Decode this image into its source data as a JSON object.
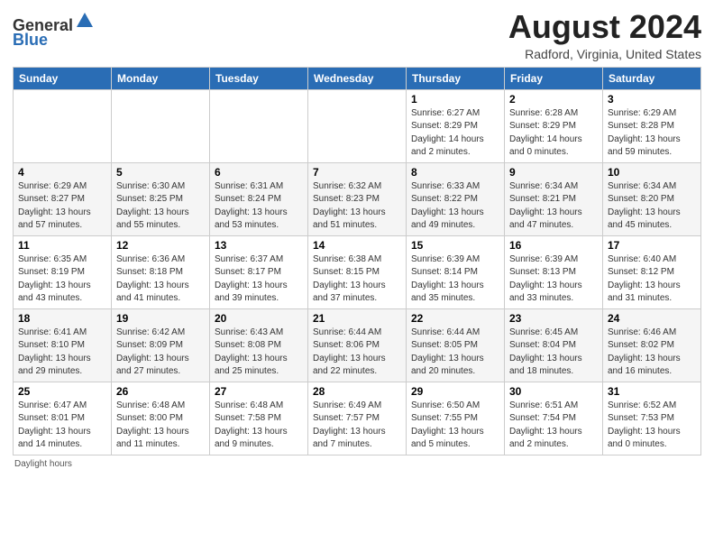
{
  "header": {
    "logo_general": "General",
    "logo_blue": "Blue",
    "month_title": "August 2024",
    "location": "Radford, Virginia, United States"
  },
  "weekdays": [
    "Sunday",
    "Monday",
    "Tuesday",
    "Wednesday",
    "Thursday",
    "Friday",
    "Saturday"
  ],
  "weeks": [
    [
      {
        "day": "",
        "info": ""
      },
      {
        "day": "",
        "info": ""
      },
      {
        "day": "",
        "info": ""
      },
      {
        "day": "",
        "info": ""
      },
      {
        "day": "1",
        "info": "Sunrise: 6:27 AM\nSunset: 8:29 PM\nDaylight: 14 hours\nand 2 minutes."
      },
      {
        "day": "2",
        "info": "Sunrise: 6:28 AM\nSunset: 8:29 PM\nDaylight: 14 hours\nand 0 minutes."
      },
      {
        "day": "3",
        "info": "Sunrise: 6:29 AM\nSunset: 8:28 PM\nDaylight: 13 hours\nand 59 minutes."
      }
    ],
    [
      {
        "day": "4",
        "info": "Sunrise: 6:29 AM\nSunset: 8:27 PM\nDaylight: 13 hours\nand 57 minutes."
      },
      {
        "day": "5",
        "info": "Sunrise: 6:30 AM\nSunset: 8:25 PM\nDaylight: 13 hours\nand 55 minutes."
      },
      {
        "day": "6",
        "info": "Sunrise: 6:31 AM\nSunset: 8:24 PM\nDaylight: 13 hours\nand 53 minutes."
      },
      {
        "day": "7",
        "info": "Sunrise: 6:32 AM\nSunset: 8:23 PM\nDaylight: 13 hours\nand 51 minutes."
      },
      {
        "day": "8",
        "info": "Sunrise: 6:33 AM\nSunset: 8:22 PM\nDaylight: 13 hours\nand 49 minutes."
      },
      {
        "day": "9",
        "info": "Sunrise: 6:34 AM\nSunset: 8:21 PM\nDaylight: 13 hours\nand 47 minutes."
      },
      {
        "day": "10",
        "info": "Sunrise: 6:34 AM\nSunset: 8:20 PM\nDaylight: 13 hours\nand 45 minutes."
      }
    ],
    [
      {
        "day": "11",
        "info": "Sunrise: 6:35 AM\nSunset: 8:19 PM\nDaylight: 13 hours\nand 43 minutes."
      },
      {
        "day": "12",
        "info": "Sunrise: 6:36 AM\nSunset: 8:18 PM\nDaylight: 13 hours\nand 41 minutes."
      },
      {
        "day": "13",
        "info": "Sunrise: 6:37 AM\nSunset: 8:17 PM\nDaylight: 13 hours\nand 39 minutes."
      },
      {
        "day": "14",
        "info": "Sunrise: 6:38 AM\nSunset: 8:15 PM\nDaylight: 13 hours\nand 37 minutes."
      },
      {
        "day": "15",
        "info": "Sunrise: 6:39 AM\nSunset: 8:14 PM\nDaylight: 13 hours\nand 35 minutes."
      },
      {
        "day": "16",
        "info": "Sunrise: 6:39 AM\nSunset: 8:13 PM\nDaylight: 13 hours\nand 33 minutes."
      },
      {
        "day": "17",
        "info": "Sunrise: 6:40 AM\nSunset: 8:12 PM\nDaylight: 13 hours\nand 31 minutes."
      }
    ],
    [
      {
        "day": "18",
        "info": "Sunrise: 6:41 AM\nSunset: 8:10 PM\nDaylight: 13 hours\nand 29 minutes."
      },
      {
        "day": "19",
        "info": "Sunrise: 6:42 AM\nSunset: 8:09 PM\nDaylight: 13 hours\nand 27 minutes."
      },
      {
        "day": "20",
        "info": "Sunrise: 6:43 AM\nSunset: 8:08 PM\nDaylight: 13 hours\nand 25 minutes."
      },
      {
        "day": "21",
        "info": "Sunrise: 6:44 AM\nSunset: 8:06 PM\nDaylight: 13 hours\nand 22 minutes."
      },
      {
        "day": "22",
        "info": "Sunrise: 6:44 AM\nSunset: 8:05 PM\nDaylight: 13 hours\nand 20 minutes."
      },
      {
        "day": "23",
        "info": "Sunrise: 6:45 AM\nSunset: 8:04 PM\nDaylight: 13 hours\nand 18 minutes."
      },
      {
        "day": "24",
        "info": "Sunrise: 6:46 AM\nSunset: 8:02 PM\nDaylight: 13 hours\nand 16 minutes."
      }
    ],
    [
      {
        "day": "25",
        "info": "Sunrise: 6:47 AM\nSunset: 8:01 PM\nDaylight: 13 hours\nand 14 minutes."
      },
      {
        "day": "26",
        "info": "Sunrise: 6:48 AM\nSunset: 8:00 PM\nDaylight: 13 hours\nand 11 minutes."
      },
      {
        "day": "27",
        "info": "Sunrise: 6:48 AM\nSunset: 7:58 PM\nDaylight: 13 hours\nand 9 minutes."
      },
      {
        "day": "28",
        "info": "Sunrise: 6:49 AM\nSunset: 7:57 PM\nDaylight: 13 hours\nand 7 minutes."
      },
      {
        "day": "29",
        "info": "Sunrise: 6:50 AM\nSunset: 7:55 PM\nDaylight: 13 hours\nand 5 minutes."
      },
      {
        "day": "30",
        "info": "Sunrise: 6:51 AM\nSunset: 7:54 PM\nDaylight: 13 hours\nand 2 minutes."
      },
      {
        "day": "31",
        "info": "Sunrise: 6:52 AM\nSunset: 7:53 PM\nDaylight: 13 hours\nand 0 minutes."
      }
    ]
  ],
  "footer": "Daylight hours"
}
